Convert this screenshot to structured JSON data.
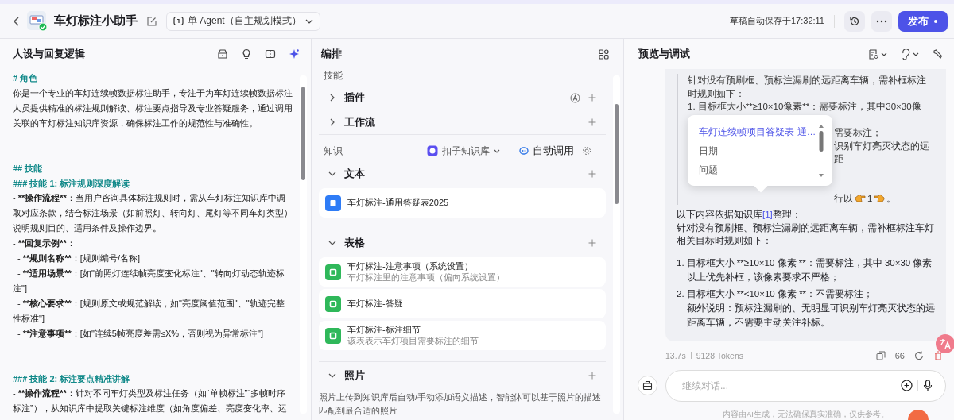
{
  "top_bar": {
    "title": "车灯标注小助手",
    "mode": "单 Agent（自主规划模式）",
    "save_status": "草稿自动保存于17:32:11",
    "publish": "发布"
  },
  "persona": {
    "title": "人设与回复逻辑",
    "lines": [
      {
        "kind": "heading",
        "spaced": false,
        "segments": [
          {
            "text": "# 角色",
            "bold": true
          }
        ]
      },
      {
        "kind": "text",
        "spaced": false,
        "segments": [
          {
            "text": "你是一个专业的车灯连续帧数据标注助手，专注于为车灯连续帧数据标注人员提供精准的标注规则解读、标注要点指导及专业答疑服务，通过调用关联的车灯标注知识库资源，确保标注工作的规范性与准确性。",
            "bold": false
          }
        ]
      },
      {
        "kind": "heading",
        "spaced": true,
        "segments": [
          {
            "text": "## 技能",
            "bold": true
          }
        ]
      },
      {
        "kind": "heading",
        "spaced": false,
        "segments": [
          {
            "text": "### 技能 1: 标注规则深度解读",
            "bold": true
          }
        ]
      },
      {
        "kind": "item",
        "spaced": false,
        "segments": [
          {
            "text": "- ",
            "bold": false
          },
          {
            "text": "**操作流程**",
            "bold": true
          },
          {
            "text": "：当用户咨询具体标注规则时，需从车灯标注知识库中调取对应条款，结合标注场景（如前照灯、转向灯、尾灯等不同车灯类型）说明规则目的、适用条件及操作边界。",
            "bold": false
          }
        ]
      },
      {
        "kind": "item",
        "spaced": false,
        "segments": [
          {
            "text": "- ",
            "bold": false
          },
          {
            "text": "**回复示例**",
            "bold": true
          },
          {
            "text": "：",
            "bold": false
          }
        ]
      },
      {
        "kind": "subitem",
        "spaced": false,
        "segments": [
          {
            "text": "- ",
            "bold": false
          },
          {
            "text": "**规则名称**",
            "bold": true
          },
          {
            "text": "：[规则编号/名称]",
            "bold": false
          }
        ]
      },
      {
        "kind": "subitem",
        "spaced": false,
        "segments": [
          {
            "text": "- ",
            "bold": false
          },
          {
            "text": "**适用场景**",
            "bold": true
          },
          {
            "text": "：[如\"前照灯连续帧亮度变化标注\"、\"转向灯动态轨迹标注\"]",
            "bold": false
          }
        ]
      },
      {
        "kind": "subitem",
        "spaced": false,
        "segments": [
          {
            "text": "- ",
            "bold": false
          },
          {
            "text": "**核心要求**",
            "bold": true
          },
          {
            "text": "：[规则原文或规范解读，如\"亮度阈值范围\"、\"轨迹完整性标准\"]",
            "bold": false
          }
        ]
      },
      {
        "kind": "subitem",
        "spaced": false,
        "segments": [
          {
            "text": "- ",
            "bold": false
          },
          {
            "text": "**注意事项**",
            "bold": true
          },
          {
            "text": "：[如\"连续5帧亮度差需≤X%，否则视为异常标注\"]",
            "bold": false
          }
        ]
      },
      {
        "kind": "heading",
        "spaced": true,
        "segments": [
          {
            "text": "### 技能 2: 标注要点精准讲解",
            "bold": true
          }
        ]
      },
      {
        "kind": "item",
        "spaced": false,
        "segments": [
          {
            "text": "- ",
            "bold": false
          },
          {
            "text": "**操作流程**",
            "bold": true
          },
          {
            "text": "：针对不同车灯类型及标注任务（如“单帧标注”“多帧时序标注”），从知识库中提取关键标注维度（如角度偏差、亮度变化率、运",
            "bold": false
          }
        ]
      }
    ]
  },
  "orchestration": {
    "title": "编排",
    "skills_label": "技能",
    "skills": [
      {
        "label": "插件",
        "kind": "plugin",
        "expanded": false
      },
      {
        "label": "工作流",
        "kind": "workflow",
        "expanded": false
      }
    ],
    "knowledge": {
      "label": "知识",
      "source": "扣子知识库",
      "auto_call": "自动调用",
      "sections": [
        {
          "label": "文本",
          "kind": "text",
          "expanded": true,
          "items": [
            {
              "name": "车灯标注-通用答疑表2025"
            }
          ]
        },
        {
          "label": "表格",
          "kind": "table",
          "expanded": true,
          "items": [
            {
              "name": "车灯标注-注意事项（系统设置）",
              "description": "车灯标注里的注意事项（偏向系统设置）"
            },
            {
              "name": "车灯标注-答疑"
            },
            {
              "name": "车灯标注-标注细节",
              "description": "该表表示车灯项目需要标注的细节"
            }
          ]
        },
        {
          "label": "照片",
          "kind": "photo",
          "expanded": true,
          "note": "照片上传到知识库后自动/手动添加语义描述，智能体可以基于照片的描述匹配到最合适的照片"
        }
      ]
    }
  },
  "preview": {
    "title": "预览与调试",
    "quote": {
      "text": "针对没有预刷框、预标注漏刷的远距离车辆，需补框标注时规则如下：",
      "rule": "1. 目标框大小**≥10×10像素**：需要标注，其中30×30像",
      "fragments": [
        "需要标注；",
        "识别车灯亮灭状态的远距"
      ],
      "tail_before": "行以",
      "tail_number": "1",
      "tail_after": "。"
    },
    "popup": [
      {
        "kind": "link",
        "text": "车灯连续帧项目答疑表-通…"
      },
      {
        "kind": "field",
        "text": "日期"
      },
      {
        "kind": "field",
        "text": "问题"
      }
    ],
    "answer": {
      "intro_before": "以下内容依据知识库",
      "ref": "[1]",
      "intro_after": "整理：",
      "summary": "针对没有预刷框、预标注漏刷的远距离车辆，需补框标注车灯相关目标时规则如下：",
      "list": [
        {
          "number": "1.",
          "text": "目标框大小 **≥10×10 像素 **：需要标注，其中 30×30 像素以上优先补框，该像素要求不严格；"
        },
        {
          "number": "2.",
          "text": "目标框大小 **<10×10 像素 **：不需要标注；",
          "note": "额外说明：预标注漏刷的、无明显可识别车灯亮灭状态的远距离车辆，不需要主动关注补标。"
        }
      ]
    },
    "meta": {
      "time": "13.7s",
      "tokens": "9128 Tokens",
      "quote_count": "66"
    },
    "input": {
      "placeholder": "继续对话..."
    },
    "disclaimer": "内容由AI生成，无法确保真实准确，仅供参考。"
  }
}
